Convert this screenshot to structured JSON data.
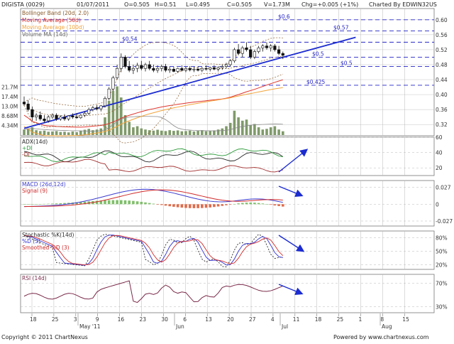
{
  "header": {
    "symbol": "DIGISTA (0029)",
    "date": "01/07/2011",
    "open": "O=0.505",
    "high": "H=0.51",
    "low": "L=0.495",
    "close": "C=0.505",
    "volume": "V=1.73M",
    "change": "Chg=+0.005 (+1%)",
    "credit": "Charted By EDWIN32US"
  },
  "footer": {
    "copyright": "Copyright © 2011 ChartNexus",
    "powered": "Powered by www.chartnexus.com"
  },
  "colors": {
    "bg": "#ffffff",
    "grid": "#b8b8b8",
    "dashed": "#2424c8",
    "trend": "#1c2cd0",
    "ma50": "#e0342c",
    "ma100": "#f2a33a",
    "bollinger": "#8a5a2a",
    "volume": "#7f9a6a",
    "volume_ma": "#888888",
    "adx": "#2a2a2a",
    "di_plus": "#2b9a3a",
    "di_minus": "#a02a2a",
    "macd": "#3b3bd0",
    "signal": "#d02a2a",
    "stoch_k": "#2a2a2a",
    "stoch_d": "#3030d0",
    "stoch_smooth": "#d02a2a",
    "rsi": "#7a2a4a"
  },
  "chart_data": {
    "type": "candlestick",
    "x_tick_labels": [
      "18",
      "25",
      "3",
      "9",
      "16",
      "23",
      "30",
      "6",
      "13",
      "20",
      "27",
      "4",
      "11",
      "18",
      "25",
      "1",
      "8",
      "15"
    ],
    "x_month_labels": [
      "May '11",
      "Jun",
      "Jul",
      "Aug"
    ],
    "price_panel": {
      "legend": [
        "Bollinger Band (20d, 2.0)",
        "Moving Average (50d)",
        "Moving Average (100d)",
        "Volume MA (14d)"
      ],
      "ylim": [
        0.29,
        0.63
      ],
      "y_ticks": [
        "0.32",
        "0.36",
        "0.40",
        "0.44",
        "0.48",
        "0.52",
        "0.56",
        "0.60"
      ],
      "volume_ticks": [
        "21.7M",
        "17.4M",
        "13.0M",
        "8.68M",
        "4.34M"
      ],
      "volume_max": 22.5,
      "levels": [
        {
          "value": 0.6,
          "label": "$0.6"
        },
        {
          "value": 0.57,
          "label": "$0.57"
        },
        {
          "value": 0.54,
          "label": "$0.54"
        },
        {
          "value": 0.5,
          "label": "$0.5"
        },
        {
          "value": 0.475,
          "label": "$0.5"
        },
        {
          "value": 0.425,
          "label": "$0.425"
        }
      ],
      "trendline": {
        "start": [
          0,
          0.31
        ],
        "end": [
          82,
          0.553
        ]
      },
      "candles": [
        [
          0.38,
          0.395,
          0.37,
          0.375
        ],
        [
          0.375,
          0.385,
          0.355,
          0.36
        ],
        [
          0.36,
          0.368,
          0.33,
          0.34
        ],
        [
          0.34,
          0.35,
          0.33,
          0.345
        ],
        [
          0.345,
          0.355,
          0.33,
          0.335
        ],
        [
          0.335,
          0.345,
          0.325,
          0.33
        ],
        [
          0.33,
          0.345,
          0.325,
          0.34
        ],
        [
          0.34,
          0.35,
          0.335,
          0.345
        ],
        [
          0.345,
          0.35,
          0.33,
          0.335
        ],
        [
          0.335,
          0.345,
          0.33,
          0.34
        ],
        [
          0.34,
          0.348,
          0.33,
          0.335
        ],
        [
          0.335,
          0.345,
          0.33,
          0.343
        ],
        [
          0.343,
          0.35,
          0.335,
          0.34
        ],
        [
          0.34,
          0.35,
          0.335,
          0.338
        ],
        [
          0.338,
          0.348,
          0.335,
          0.345
        ],
        [
          0.345,
          0.355,
          0.34,
          0.35
        ],
        [
          0.35,
          0.365,
          0.345,
          0.36
        ],
        [
          0.36,
          0.37,
          0.355,
          0.365
        ],
        [
          0.365,
          0.372,
          0.358,
          0.362
        ],
        [
          0.362,
          0.372,
          0.355,
          0.37
        ],
        [
          0.37,
          0.395,
          0.365,
          0.39
        ],
        [
          0.39,
          0.42,
          0.385,
          0.415
        ],
        [
          0.415,
          0.45,
          0.41,
          0.445
        ],
        [
          0.445,
          0.48,
          0.44,
          0.47
        ],
        [
          0.47,
          0.51,
          0.46,
          0.5
        ],
        [
          0.5,
          0.505,
          0.47,
          0.475
        ],
        [
          0.475,
          0.49,
          0.46,
          0.465
        ],
        [
          0.465,
          0.48,
          0.455,
          0.47
        ],
        [
          0.47,
          0.485,
          0.46,
          0.478
        ],
        [
          0.478,
          0.49,
          0.465,
          0.47
        ],
        [
          0.47,
          0.485,
          0.462,
          0.48
        ],
        [
          0.48,
          0.49,
          0.465,
          0.47
        ],
        [
          0.47,
          0.48,
          0.46,
          0.465
        ],
        [
          0.465,
          0.478,
          0.458,
          0.47
        ],
        [
          0.47,
          0.48,
          0.462,
          0.475
        ],
        [
          0.475,
          0.482,
          0.46,
          0.465
        ],
        [
          0.465,
          0.475,
          0.458,
          0.468
        ],
        [
          0.468,
          0.475,
          0.46,
          0.462
        ],
        [
          0.462,
          0.472,
          0.458,
          0.47
        ],
        [
          0.47,
          0.478,
          0.462,
          0.465
        ],
        [
          0.465,
          0.475,
          0.46,
          0.47
        ],
        [
          0.47,
          0.476,
          0.462,
          0.466
        ],
        [
          0.466,
          0.474,
          0.46,
          0.468
        ],
        [
          0.468,
          0.476,
          0.462,
          0.465
        ],
        [
          0.465,
          0.474,
          0.46,
          0.47
        ],
        [
          0.47,
          0.478,
          0.464,
          0.468
        ],
        [
          0.468,
          0.475,
          0.462,
          0.472
        ],
        [
          0.472,
          0.478,
          0.465,
          0.468
        ],
        [
          0.468,
          0.476,
          0.462,
          0.472
        ],
        [
          0.472,
          0.48,
          0.466,
          0.475
        ],
        [
          0.475,
          0.485,
          0.47,
          0.48
        ],
        [
          0.48,
          0.495,
          0.475,
          0.49
        ],
        [
          0.49,
          0.525,
          0.485,
          0.52
        ],
        [
          0.52,
          0.535,
          0.505,
          0.51
        ],
        [
          0.51,
          0.53,
          0.5,
          0.525
        ],
        [
          0.525,
          0.54,
          0.515,
          0.52
        ],
        [
          0.52,
          0.53,
          0.495,
          0.5
        ],
        [
          0.5,
          0.52,
          0.495,
          0.515
        ],
        [
          0.515,
          0.53,
          0.51,
          0.525
        ],
        [
          0.525,
          0.535,
          0.515,
          0.53
        ],
        [
          0.53,
          0.54,
          0.52,
          0.525
        ],
        [
          0.525,
          0.535,
          0.515,
          0.53
        ],
        [
          0.53,
          0.535,
          0.515,
          0.52
        ],
        [
          0.52,
          0.53,
          0.505,
          0.51
        ],
        [
          0.51,
          0.515,
          0.495,
          0.505
        ]
      ],
      "volume": [
        2.5,
        3.0,
        3.5,
        2.2,
        1.8,
        2.0,
        1.5,
        1.6,
        1.8,
        1.4,
        1.5,
        1.2,
        1.6,
        1.3,
        2.0,
        2.4,
        2.8,
        2.2,
        2.5,
        3.0,
        8.0,
        15.5,
        20.0,
        22.0,
        17.0,
        9.0,
        6.0,
        3.5,
        4.0,
        3.0,
        2.5,
        2.2,
        2.0,
        2.4,
        2.0,
        1.8,
        2.2,
        1.9,
        2.1,
        1.7,
        1.8,
        2.0,
        1.6,
        1.9,
        2.2,
        1.7,
        1.8,
        2.1,
        2.5,
        3.0,
        4.0,
        5.5,
        11.0,
        8.0,
        6.5,
        7.0,
        4.5,
        5.0,
        3.5,
        2.5,
        2.8,
        3.5,
        4.0,
        2.5,
        1.7
      ]
    },
    "adx_panel": {
      "legend": [
        "ADX(14d)",
        "+DI",
        "-DI"
      ],
      "ylim": [
        10,
        60
      ],
      "y_ticks": [
        "60",
        "40",
        "20"
      ]
    },
    "macd_panel": {
      "legend": [
        "MACD (26d,12d)",
        "Signal (9)"
      ],
      "ylim": [
        -0.035,
        0.038
      ],
      "y_ticks": [
        "0.027",
        "0",
        "-0.027"
      ]
    },
    "stoch_panel": {
      "legend": [
        "Stochastic %K(14d)",
        "%D (3)",
        "Smoothed %D (3)"
      ],
      "ylim": [
        10,
        95
      ],
      "y_ticks": [
        "80%",
        "50%",
        "20%"
      ]
    },
    "rsi_panel": {
      "legend": [
        "RSI (14d)"
      ],
      "ylim": [
        20,
        85
      ],
      "y_ticks": [
        "70%",
        "30%"
      ]
    }
  }
}
